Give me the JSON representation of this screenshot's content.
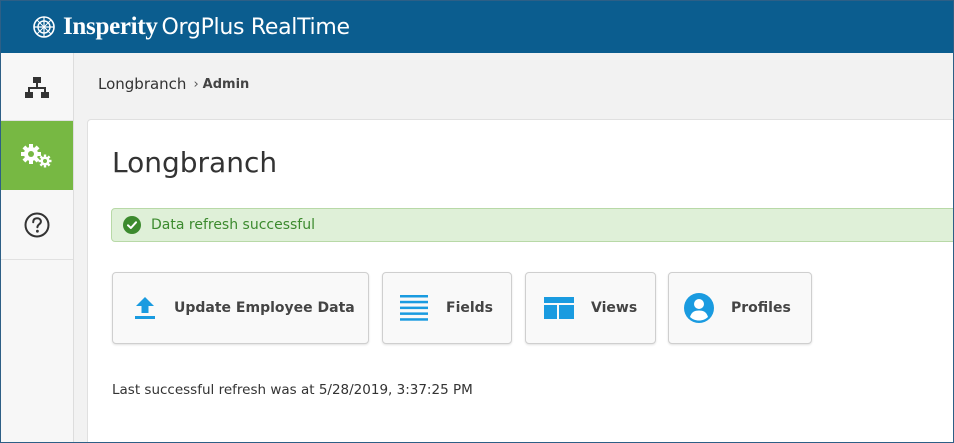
{
  "header": {
    "brand_name": "Insperity",
    "product_name": "OrgPlus RealTime",
    "background_color": "#0b5d8f"
  },
  "sidebar": {
    "items": [
      {
        "icon": "org-chart-icon",
        "active": false
      },
      {
        "icon": "gears-icon",
        "active": true
      },
      {
        "icon": "help-icon",
        "active": false
      }
    ],
    "active_color": "#77b843"
  },
  "breadcrumb": {
    "parent": "Longbranch",
    "separator": "›",
    "current": "Admin"
  },
  "main": {
    "title": "Longbranch",
    "alert": {
      "icon": "check-circle-icon",
      "text": "Data refresh successful",
      "color": "#3c8a2e",
      "background": "#dff0d8"
    },
    "actions": [
      {
        "label": "Update Employee Data",
        "icon": "upload-icon"
      },
      {
        "label": "Fields",
        "icon": "list-icon"
      },
      {
        "label": "Views",
        "icon": "views-icon"
      },
      {
        "label": "Profiles",
        "icon": "user-circle-icon"
      }
    ],
    "icon_color": "#1a9be0",
    "last_refresh": "Last successful refresh was at 5/28/2019, 3:37:25 PM"
  }
}
